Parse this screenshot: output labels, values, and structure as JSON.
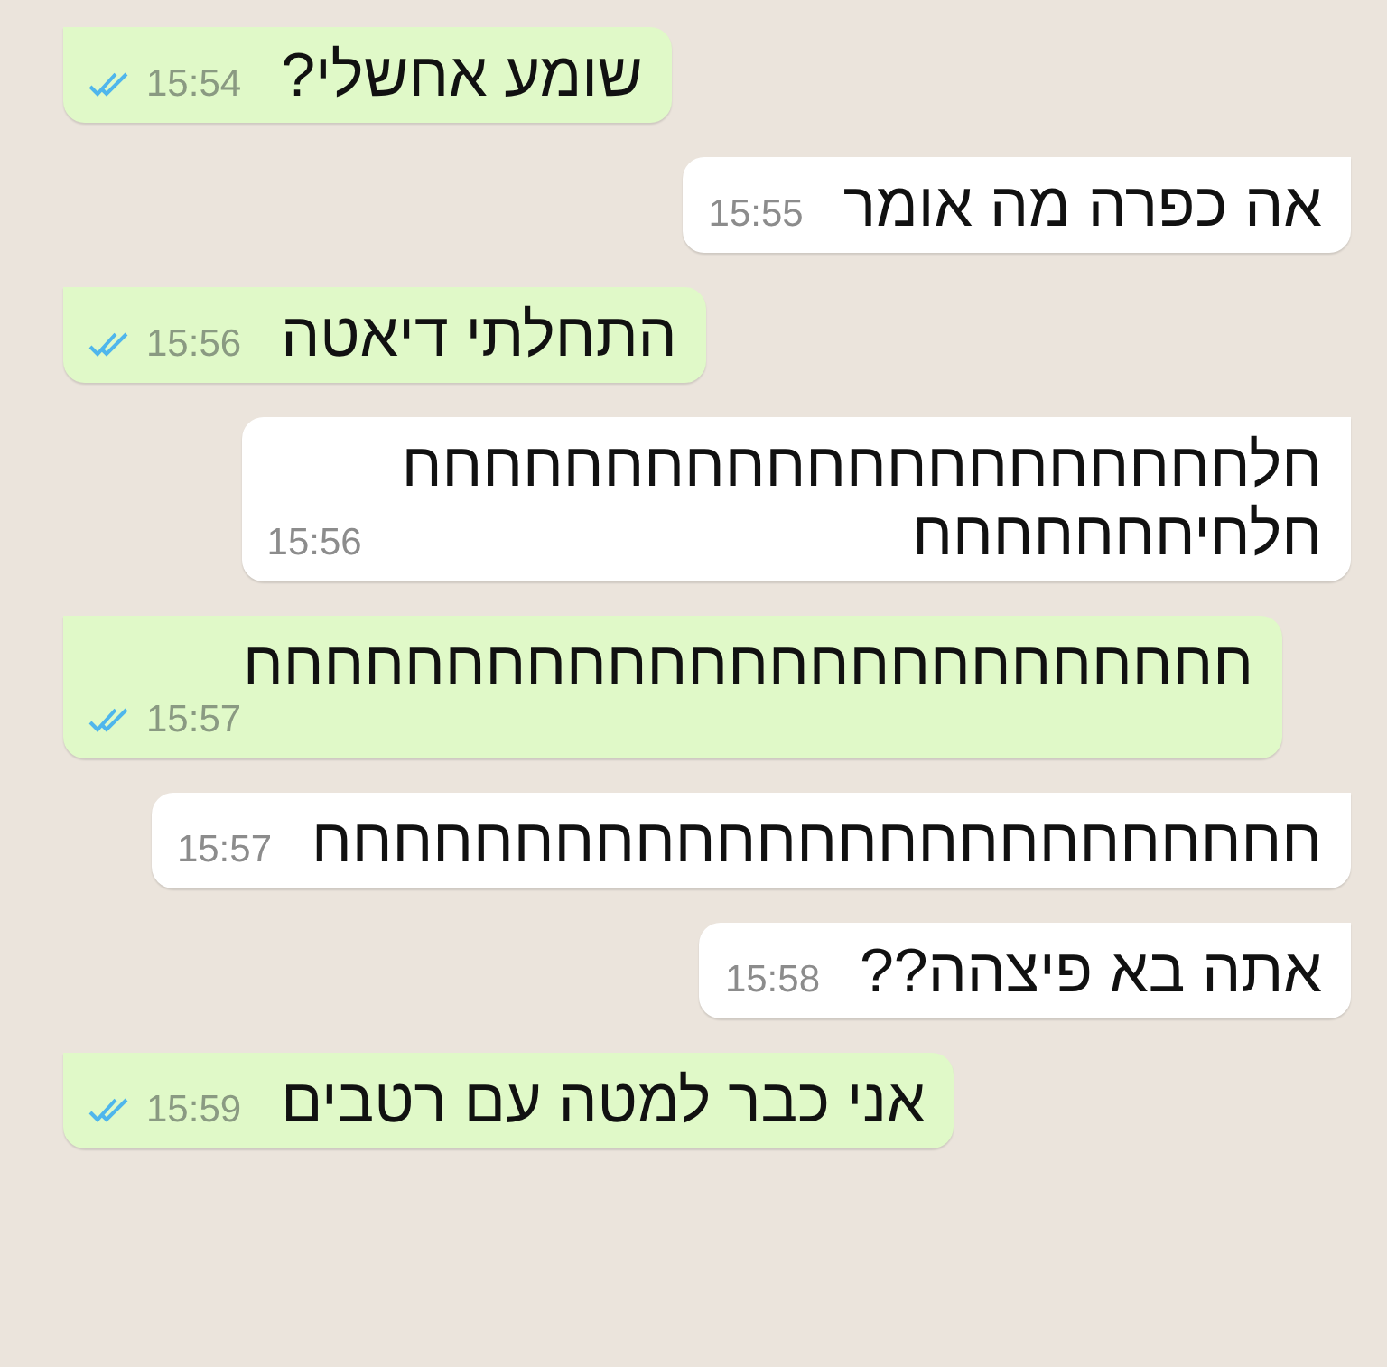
{
  "messages": [
    {
      "kind": "outgoing",
      "text": "שומע אחשלי?",
      "time": "15:54",
      "read": true
    },
    {
      "kind": "incoming",
      "text": "אה כפרה מה אומר",
      "time": "15:55"
    },
    {
      "kind": "outgoing",
      "text": "התחלתי דיאטה",
      "time": "15:56",
      "read": true
    },
    {
      "kind": "incoming",
      "text": "חלחחחחחחחחחחחחחחחחחחחחח\nחלחיחחחחחחח",
      "time": "15:56"
    },
    {
      "kind": "outgoing",
      "text": "חחחחחחחחחחחחחחחחחחחחחחחחח",
      "time": "15:57",
      "read": true
    },
    {
      "kind": "incoming",
      "text": "חחחחחחחחחחחחחחחחחחחחחחחחח",
      "time": "15:57"
    },
    {
      "kind": "incoming",
      "text": "אתה בא פיצהה??",
      "time": "15:58"
    },
    {
      "kind": "outgoing",
      "text": "אני כבר למטה עם רטבים",
      "time": "15:59",
      "read": true
    }
  ]
}
